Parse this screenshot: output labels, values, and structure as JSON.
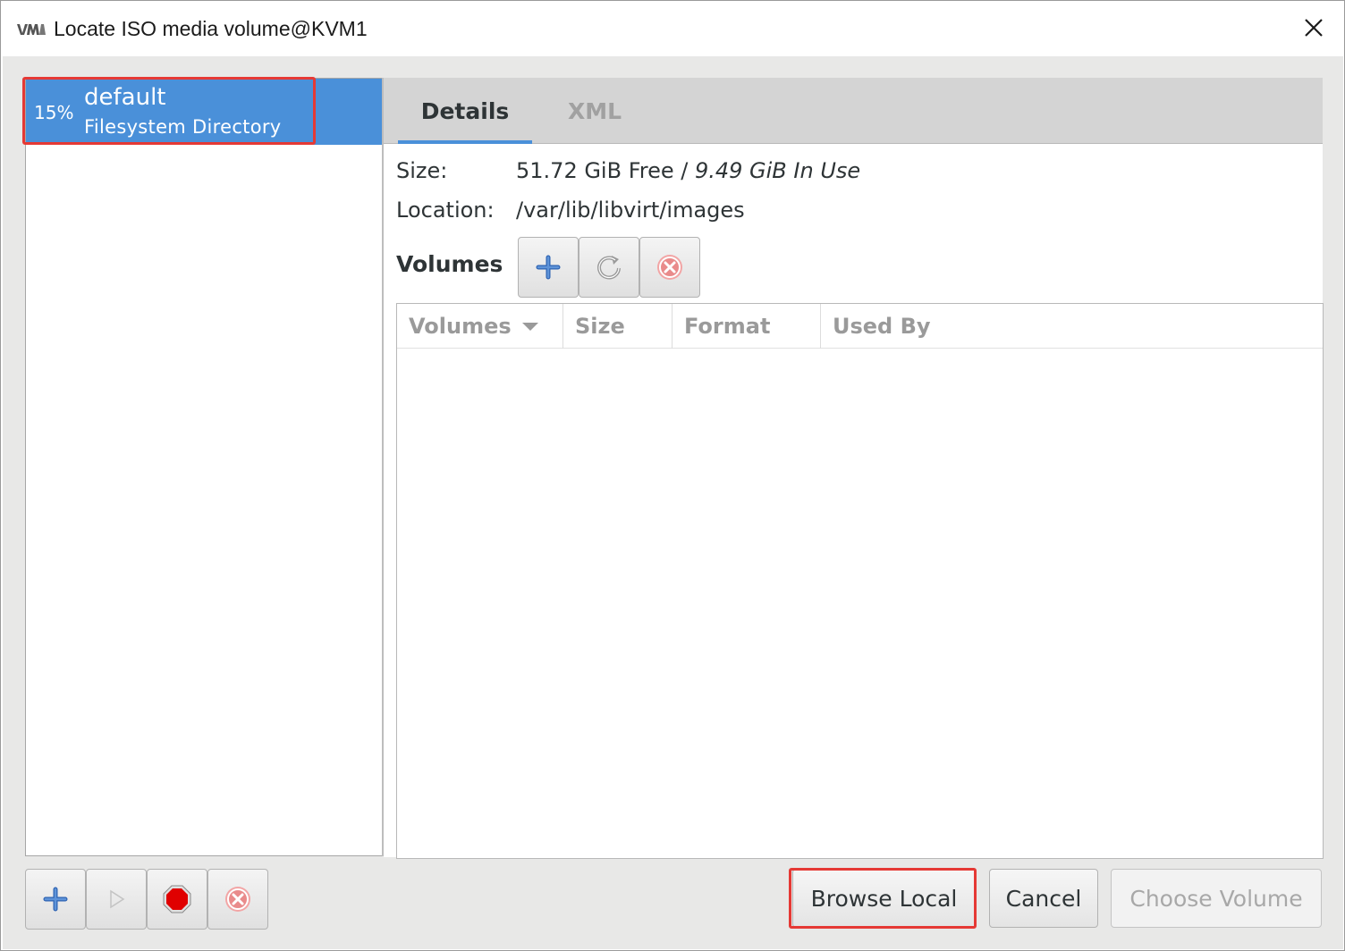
{
  "window": {
    "title": "Locate ISO media volume@KVM1",
    "app_icon": "virt-manager-logo-icon",
    "close_icon": "close-icon"
  },
  "pool_list": {
    "items": [
      {
        "usage": "15%",
        "name": "default",
        "type": "Filesystem Directory",
        "selected": true
      }
    ],
    "toolbar": {
      "add_icon": "plus-icon",
      "start_icon": "play-icon",
      "stop_icon": "stop-icon",
      "delete_icon": "delete-icon"
    }
  },
  "tabs": [
    {
      "label": "Details",
      "active": true
    },
    {
      "label": "XML",
      "active": false
    }
  ],
  "details": {
    "size_label": "Size:",
    "size_free": "51.72 GiB Free",
    "size_sep": " / ",
    "size_in_use": "9.49 GiB In Use",
    "location_label": "Location:",
    "location_value": "/var/lib/libvirt/images",
    "volumes_label": "Volumes",
    "volume_toolbar": {
      "add_icon": "plus-icon",
      "refresh_icon": "refresh-icon",
      "delete_icon": "delete-icon"
    },
    "volumes_table": {
      "columns": [
        "Volumes",
        "Size",
        "Format",
        "Used By"
      ],
      "sorted_column": "Volumes",
      "rows": []
    }
  },
  "buttons": {
    "browse_local": "Browse Local",
    "cancel": "Cancel",
    "choose_volume": "Choose Volume"
  },
  "colors": {
    "selection": "#4a90d9",
    "highlight": "#e53935",
    "disabled_text": "#a8a8a8"
  }
}
